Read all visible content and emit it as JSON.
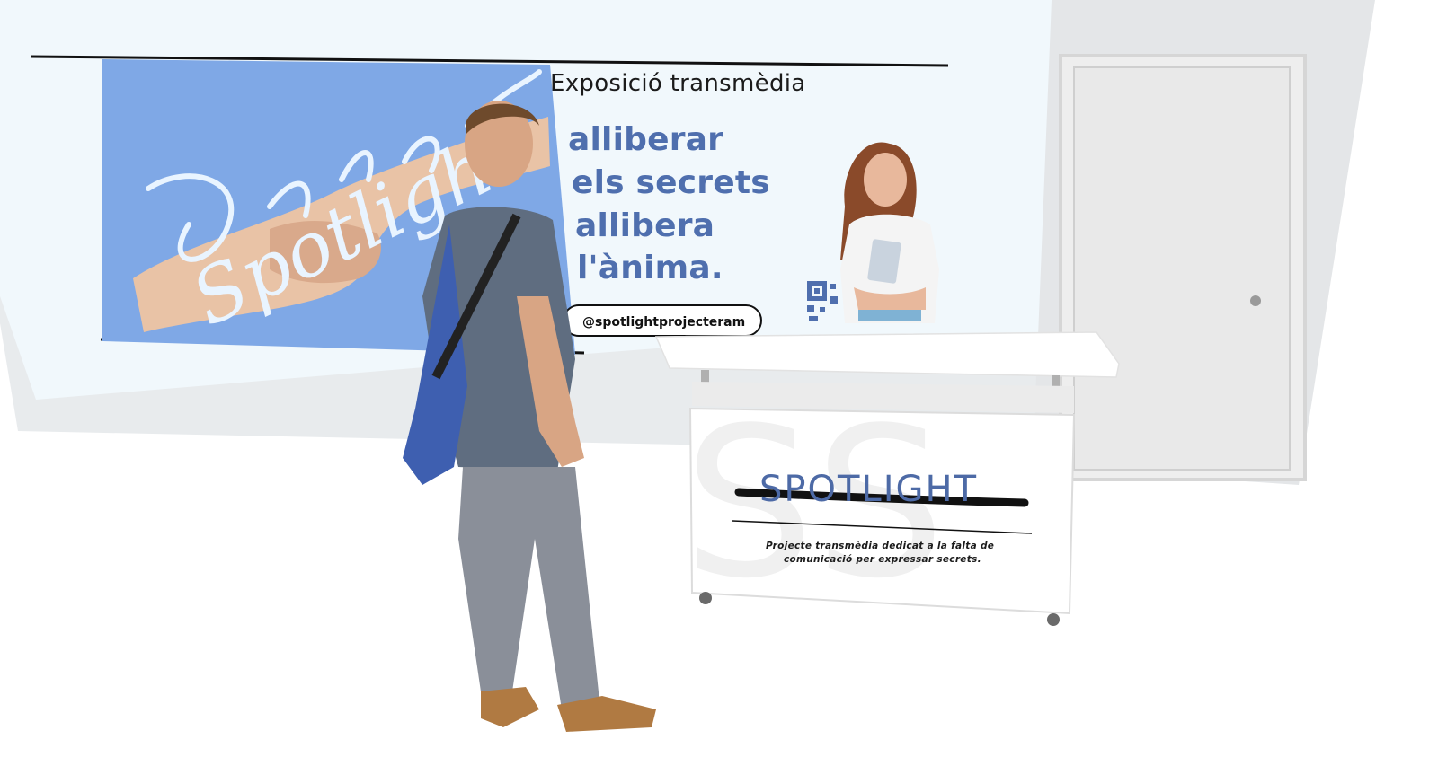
{
  "banner": {
    "subtitle": "Exposició transmèdia",
    "lines": [
      "alliberar",
      "els secrets",
      "allibera",
      "l'ànima."
    ],
    "handle": "@spotlightprojecteram",
    "script_logo": "Spotlight"
  },
  "counter": {
    "brand": "SPOTLIGHT",
    "tagline_lines": [
      "Projecte transmèdia dedicat a la falta de",
      "comunicació per expressar secrets."
    ]
  },
  "colors": {
    "accent_blue": "#4f6fae",
    "photo_blue": "#7fa8e6",
    "wall": "#f1f8fc"
  },
  "icons": [
    "qr-code-icon",
    "door-knob-icon"
  ]
}
